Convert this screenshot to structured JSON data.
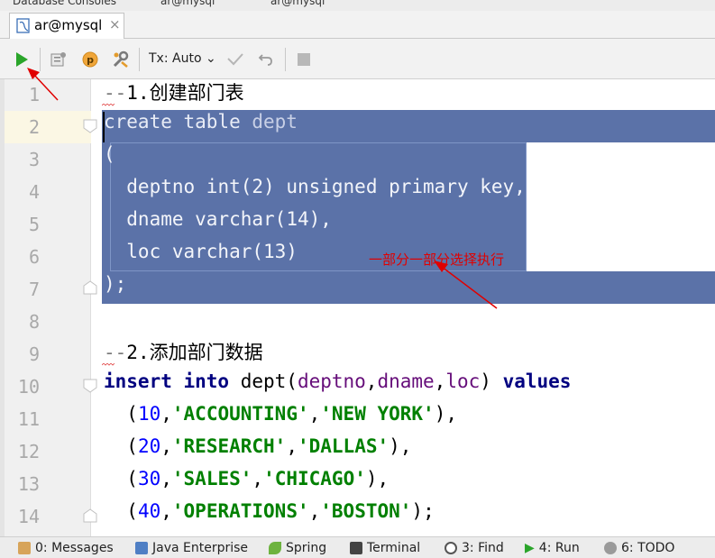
{
  "breadcrumb": {
    "items": [
      "Database Consoles",
      "ar@mysql",
      "ar@mysql"
    ]
  },
  "tab": {
    "label": "ar@mysql",
    "close": "×"
  },
  "toolbar": {
    "tx_mode": "Tx: Auto"
  },
  "line_numbers": [
    "1",
    "2",
    "3",
    "4",
    "5",
    "6",
    "7",
    "8",
    "9",
    "10",
    "11",
    "12",
    "13",
    "14"
  ],
  "code": {
    "l1_dash": "--",
    "l1_text": "1.创建部门表",
    "l2_kw": "create table",
    "l2_name": " dept",
    "l3": "(",
    "l4_col": "  deptno ",
    "l4_type": "int",
    "l4_args": "(2) ",
    "l4_kw": "unsigned primary key",
    "l4_end": ",",
    "l5_col": "  dname ",
    "l5_type": "varchar",
    "l5_args": "(14),",
    "l6_col": "  loc ",
    "l6_type": "varchar",
    "l6_args": "(13)",
    "l7": ");",
    "l9_dash": "--",
    "l9_text": "2.添加部门数据",
    "l10_kw1": "insert into",
    "l10_tbl": " dept(",
    "l10_c1": "deptno",
    "l10_comma1": ",",
    "l10_c2": "dname",
    "l10_comma2": ",",
    "l10_c3": "loc",
    "l10_paren": ") ",
    "l10_kw2": "values",
    "rows": [
      {
        "open": "  (",
        "num": "10",
        "sep": ",",
        "s1": "'ACCOUNTING'",
        "sep2": ",",
        "s2": "'NEW YORK'",
        "close": "),"
      },
      {
        "open": "  (",
        "num": "20",
        "sep": ",",
        "s1": "'RESEARCH'",
        "sep2": ",",
        "s2": "'DALLAS'",
        "close": "),"
      },
      {
        "open": "  (",
        "num": "30",
        "sep": ",",
        "s1": "'SALES'",
        "sep2": ",",
        "s2": "'CHICAGO'",
        "close": "),"
      },
      {
        "open": "  (",
        "num": "40",
        "sep": ",",
        "s1": "'OPERATIONS'",
        "sep2": ",",
        "s2": "'BOSTON'",
        "close": ");"
      }
    ]
  },
  "annotation": "一部分一部分选择执行",
  "status": {
    "messages": "0: Messages",
    "java_enterprise": "Java Enterprise",
    "spring": "Spring",
    "terminal": "Terminal",
    "find": "3: Find",
    "run": "4: Run",
    "todo": "6: TODO"
  },
  "colors": {
    "selection": "#5b72a8",
    "keyword": "#000080",
    "string": "#008000",
    "number": "#0000ff",
    "annotation": "#e00000"
  }
}
